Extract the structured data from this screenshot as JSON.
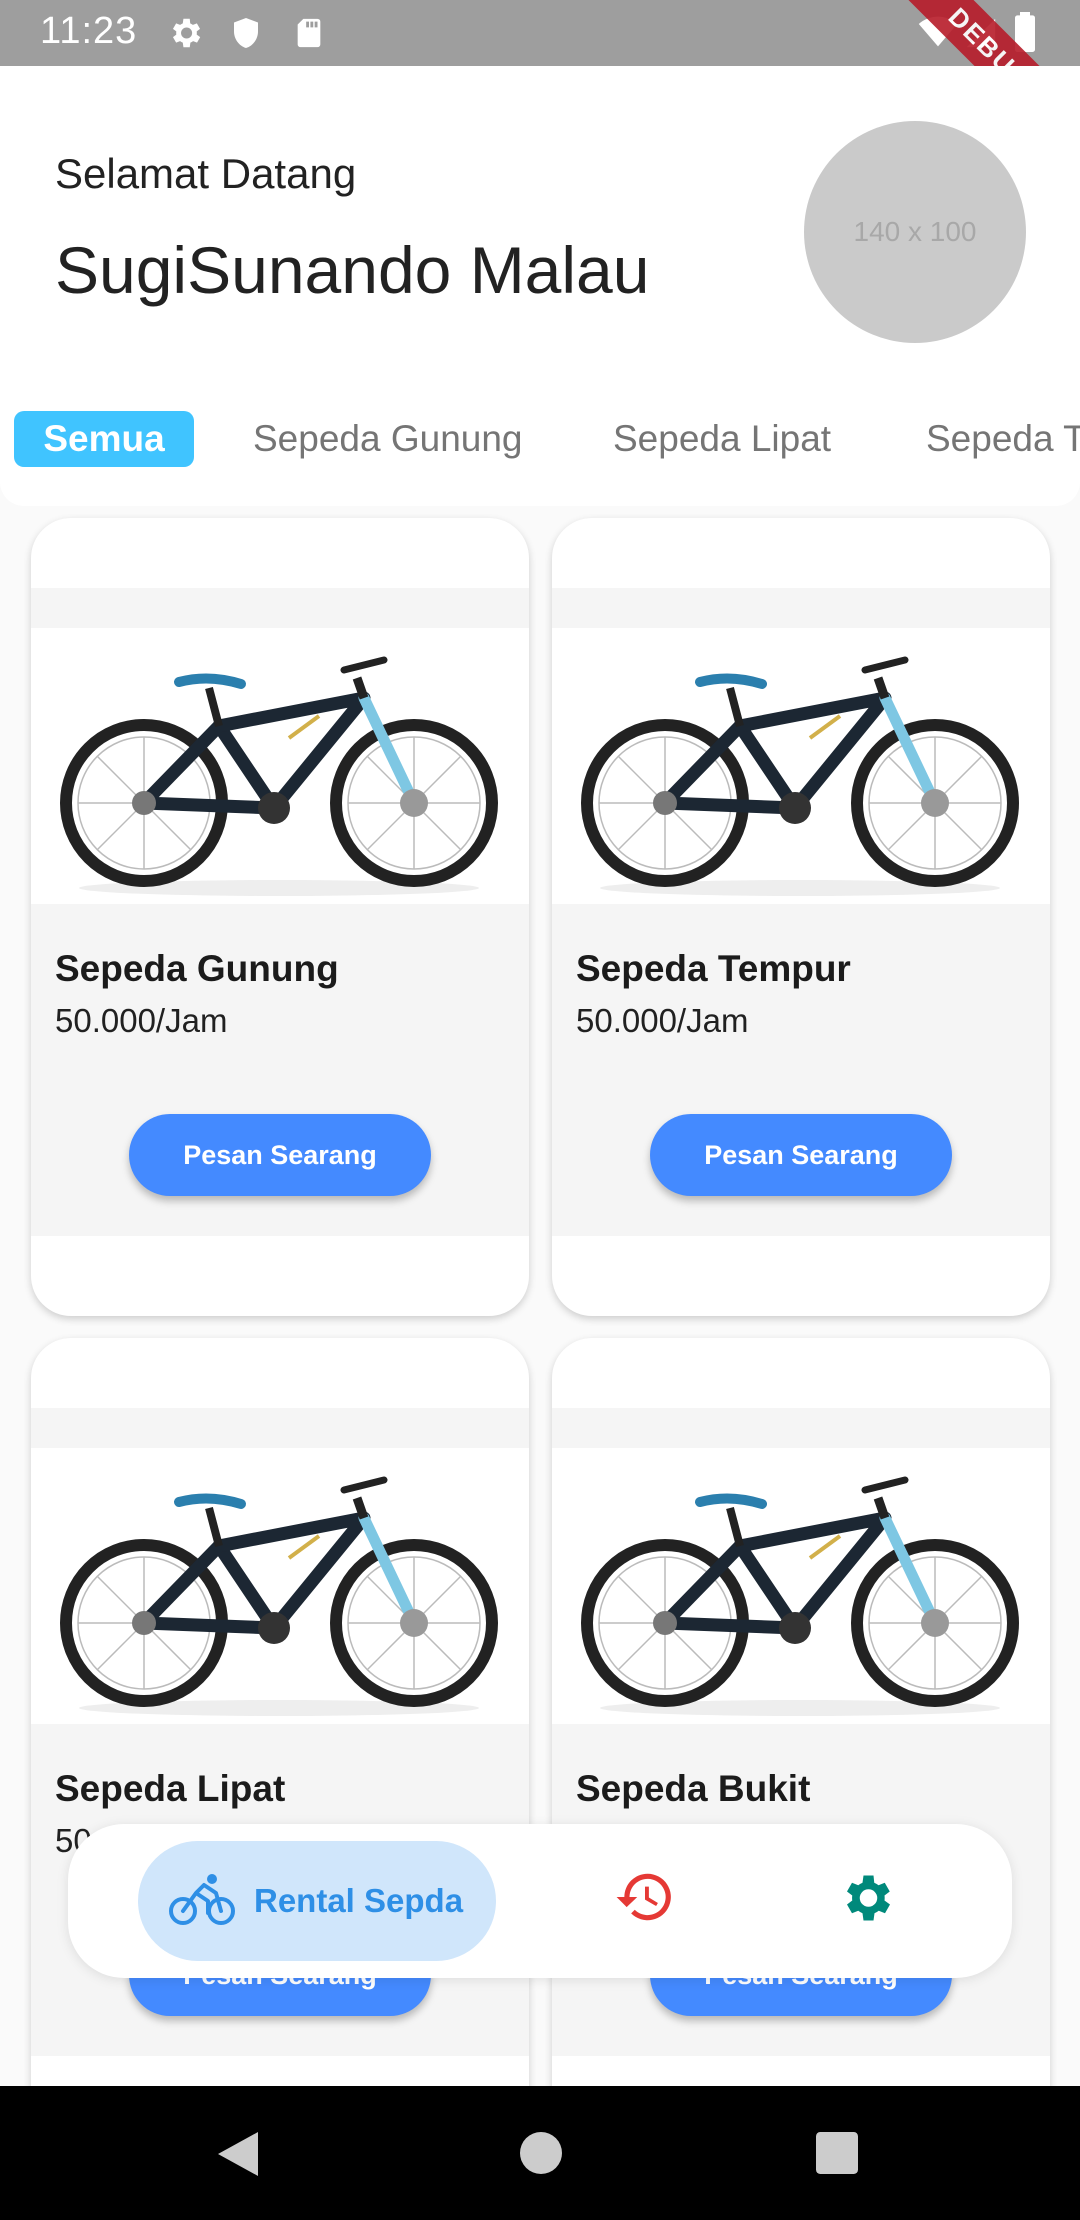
{
  "status_bar": {
    "time": "11:23",
    "left_icons": [
      "gear-icon",
      "shield-icon",
      "sd-card-icon"
    ],
    "right_icons": [
      "wifi-icon",
      "signal-icon",
      "battery-icon"
    ],
    "debug_label": "DEBUG"
  },
  "header": {
    "greeting": "Selamat Datang",
    "user_name": "SugiSunando Malau",
    "avatar_placeholder": "140 x 100"
  },
  "tabs": [
    {
      "label": "Semua",
      "active": true
    },
    {
      "label": "Sepeda Gunung",
      "active": false
    },
    {
      "label": "Sepeda Lipat",
      "active": false
    },
    {
      "label": "Sepeda T",
      "active": false
    }
  ],
  "products": [
    {
      "name": "Sepeda Gunung",
      "price": "50.000/Jam",
      "button": "Pesan Searang"
    },
    {
      "name": "Sepeda Tempur",
      "price": "50.000/Jam",
      "button": "Pesan Searang"
    },
    {
      "name": "Sepeda Lipat",
      "price": "50",
      "button": "Pesan Searang"
    },
    {
      "name": "Sepeda Bukit",
      "price": "",
      "button": "Pesan Searang"
    }
  ],
  "bottom_nav": {
    "items": [
      {
        "label": "Rental Sepda",
        "icon": "bicycle-icon",
        "active": true
      },
      {
        "label": "",
        "icon": "history-icon",
        "active": false
      },
      {
        "label": "",
        "icon": "settings-icon",
        "active": false
      }
    ],
    "colors": {
      "active_bg": "#d0e6fb",
      "active_fg": "#2e8fe6",
      "history": "#e53935",
      "settings": "#00897b"
    }
  },
  "colors": {
    "tab_active": "#40c4ff",
    "button": "#448aff",
    "status_bar": "#9e9e9e"
  }
}
